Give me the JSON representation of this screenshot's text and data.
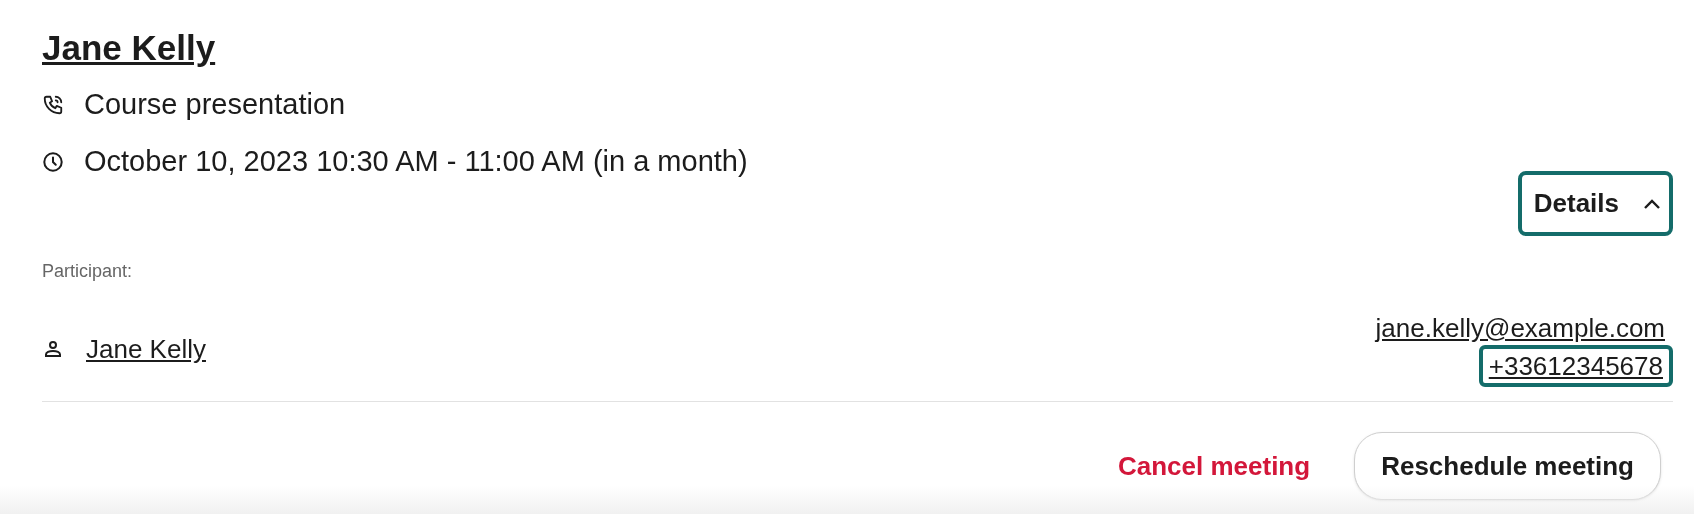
{
  "meeting": {
    "title": "Jane Kelly",
    "type": "Course presentation",
    "time": "October 10, 2023 10:30 AM - 11:00 AM (in a month)"
  },
  "details_toggle": {
    "label": "Details",
    "expanded": true,
    "focused": true
  },
  "participants_label": "Participant:",
  "participants": [
    {
      "name": "Jane Kelly",
      "email": "jane.kelly@example.com",
      "phone": "+33612345678",
      "phone_focused": true
    }
  ],
  "actions": [
    {
      "label": "Cancel meeting",
      "kind": "danger"
    },
    {
      "label": "Reschedule meeting",
      "kind": "outline"
    }
  ]
}
